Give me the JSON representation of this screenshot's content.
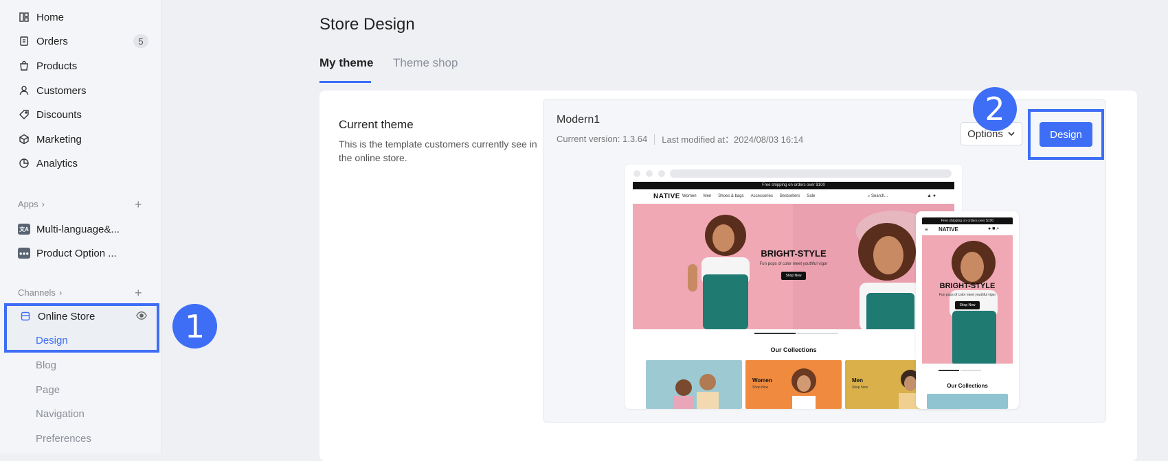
{
  "sidebar": {
    "items": [
      {
        "label": "Home",
        "icon": "home-icon"
      },
      {
        "label": "Orders",
        "icon": "orders-icon",
        "badge": "5"
      },
      {
        "label": "Products",
        "icon": "products-icon"
      },
      {
        "label": "Customers",
        "icon": "customers-icon"
      },
      {
        "label": "Discounts",
        "icon": "discounts-icon"
      },
      {
        "label": "Marketing",
        "icon": "marketing-icon"
      },
      {
        "label": "Analytics",
        "icon": "analytics-icon"
      }
    ],
    "apps_label": "Apps",
    "apps": [
      {
        "label": "Multi-language&...",
        "icon": "multi-language-app-icon"
      },
      {
        "label": "Product Option ...",
        "icon": "product-option-app-icon"
      }
    ],
    "channels_label": "Channels",
    "online_store": {
      "label": "Online Store",
      "subitems": [
        "Design",
        "Blog",
        "Page",
        "Navigation",
        "Preferences"
      ],
      "active": "Design"
    }
  },
  "annotations": {
    "step1": "1",
    "step2": "2",
    "highlight_color": "#3d6ef5"
  },
  "main": {
    "title": "Store Design",
    "tabs": [
      {
        "label": "My theme",
        "active": true
      },
      {
        "label": "Theme shop",
        "active": false
      }
    ],
    "current_theme": {
      "heading": "Current theme",
      "description": "This is the template customers currently see in the online store."
    },
    "theme": {
      "name": "Modern1",
      "version": "Current version: 1.3.64",
      "modified": "Last modified at：2024/08/03 16:14",
      "options_label": "Options",
      "design_label": "Design"
    },
    "preview": {
      "promo_bar": "Free shipping on orders over $100",
      "logo": "NATIVE",
      "nav_links": [
        "Women",
        "Men",
        "Shoes & bags",
        "Accessories",
        "Bestsellers",
        "Sale"
      ],
      "search_placeholder": "Search...",
      "hero_title": "BRIGHT-STYLE",
      "hero_subtitle": "Fun pops of color meet youthful vigor",
      "hero_button": "Shop Now",
      "collections_title": "Our Collections",
      "collections": [
        "Women",
        "Men"
      ],
      "collection_link": "Shop Now",
      "mobile_promo": "Free shipping on orders over $100"
    }
  },
  "colors": {
    "accent": "#3d6ef5",
    "sidebar_bg": "#f4f5f8",
    "page_bg": "#eef0f3"
  }
}
